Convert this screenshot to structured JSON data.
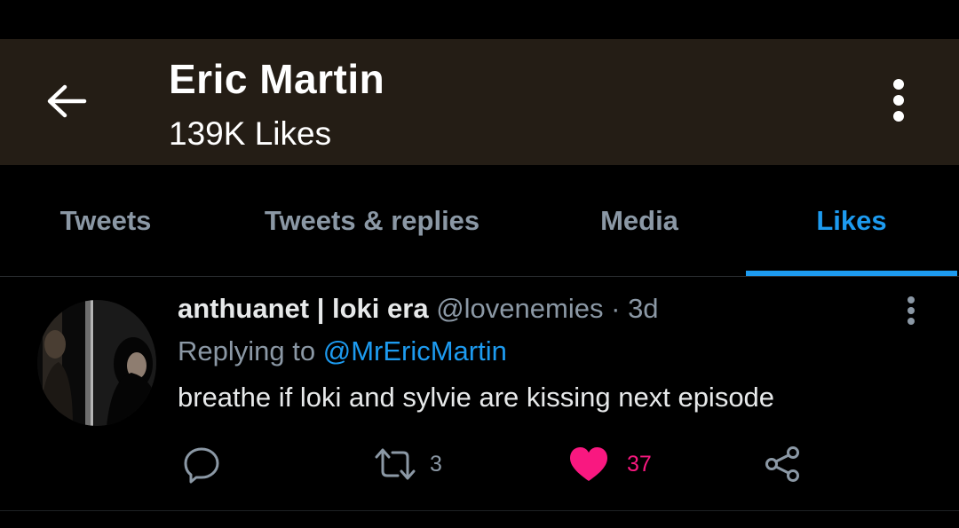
{
  "header": {
    "title": "Eric Martin",
    "subtitle": "139K Likes",
    "back_icon": "back-arrow-icon",
    "more_icon": "more-vertical-icon"
  },
  "tabs": [
    {
      "label": "Tweets",
      "active": false
    },
    {
      "label": "Tweets & replies",
      "active": false
    },
    {
      "label": "Media",
      "active": false
    },
    {
      "label": "Likes",
      "active": true
    }
  ],
  "tweet": {
    "display_name": "anthuanet | loki era",
    "handle": "@lovenemies",
    "separator": "·",
    "age": "3d",
    "replying_prefix": "Replying to",
    "replying_handle": "@MrEricMartin",
    "text": "breathe if loki and sylvie are kissing next episode",
    "actions": {
      "reply": {
        "icon": "reply-icon"
      },
      "retweet": {
        "icon": "retweet-icon",
        "count": "3"
      },
      "like": {
        "icon": "heart-icon",
        "count": "37",
        "liked": true
      },
      "share": {
        "icon": "share-icon"
      }
    }
  },
  "colors": {
    "header_bg": "#241d15",
    "background": "#000000",
    "accent": "#1d9bf0",
    "like": "#f91880",
    "secondary_text": "#8b98a5",
    "primary_text": "#e7e9ea"
  }
}
